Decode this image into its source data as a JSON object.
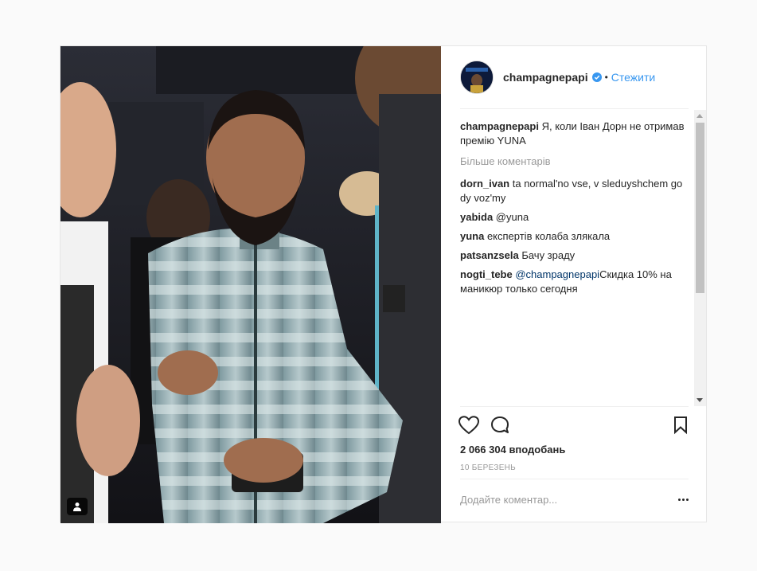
{
  "post": {
    "username": "champagnepapi",
    "follow_label": "Стежити",
    "separator": "•",
    "caption": {
      "user": "champagnepapi",
      "text": " Я, коли Іван Дорн не отримав премію YUNA"
    },
    "more_comments_label": "Більше коментарів",
    "comments": [
      {
        "user": "dorn_ivan",
        "mention": "",
        "text": " ta normal'no vse, v sleduyshchem go dy voz'my"
      },
      {
        "user": "yabida",
        "mention": "",
        "text": " @yuna"
      },
      {
        "user": "yuna",
        "mention": "",
        "text": " експертів колаба злякала"
      },
      {
        "user": "patsanzsela",
        "mention": "",
        "text": " Бачу зраду"
      },
      {
        "user": "nogti_tebe",
        "mention": " @champagnepapi",
        "text": "Скидка 10% на маникюр только сегодня"
      }
    ],
    "likes_label": "2 066 304 вподобань",
    "date_label": "10 БЕРЕЗЕНЬ",
    "add_comment_placeholder": "Додайте коментар...",
    "icons": {
      "like": "heart-icon",
      "comment": "comment-icon",
      "save": "bookmark-icon",
      "verified": "verified-badge-icon",
      "tagged": "user-tag-icon",
      "options": "more-options-icon"
    },
    "colors": {
      "link": "#3897f0",
      "mention": "#003569",
      "muted": "#999999",
      "text": "#262626"
    }
  }
}
